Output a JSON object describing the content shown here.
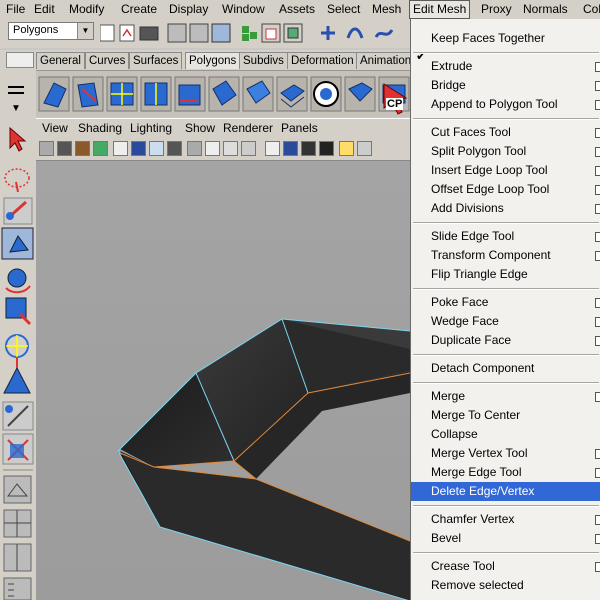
{
  "menubar": {
    "items": [
      "File",
      "Edit",
      "Modify",
      "Create",
      "Display",
      "Window",
      "Assets",
      "Select",
      "Mesh",
      "Edit Mesh",
      "Proxy",
      "Normals",
      "Col"
    ],
    "active_index": 9
  },
  "status_line": {
    "menu_set": "Polygons"
  },
  "shelf": {
    "tabs": [
      "General",
      "Curves",
      "Surfaces",
      "Polygons",
      "Subdivs",
      "Deformation",
      "Animation"
    ],
    "selected_tab_index": 3,
    "cp_label": "CP"
  },
  "panel": {
    "menus": [
      "View",
      "Shading",
      "Lighting",
      "Show",
      "Renderer",
      "Panels"
    ]
  },
  "edit_mesh_menu": {
    "header": {
      "label": "Keep Faces Together",
      "checked": true
    },
    "groups": [
      [
        {
          "label": "Extrude",
          "option": true
        },
        {
          "label": "Bridge",
          "option": true
        },
        {
          "label": "Append to Polygon Tool",
          "option": true
        }
      ],
      [
        {
          "label": "Cut Faces Tool",
          "option": true
        },
        {
          "label": "Split Polygon Tool",
          "option": true
        },
        {
          "label": "Insert Edge Loop Tool",
          "option": true
        },
        {
          "label": "Offset Edge Loop Tool",
          "option": true
        },
        {
          "label": "Add Divisions",
          "option": true
        }
      ],
      [
        {
          "label": "Slide Edge Tool",
          "option": true
        },
        {
          "label": "Transform Component",
          "option": true
        },
        {
          "label": "Flip Triangle Edge",
          "option": false
        }
      ],
      [
        {
          "label": "Poke Face",
          "option": true
        },
        {
          "label": "Wedge Face",
          "option": true
        },
        {
          "label": "Duplicate Face",
          "option": true
        }
      ],
      [
        {
          "label": "Detach Component",
          "option": false
        }
      ],
      [
        {
          "label": "Merge",
          "option": true
        },
        {
          "label": "Merge To Center",
          "option": false
        },
        {
          "label": "Collapse",
          "option": false
        },
        {
          "label": "Merge Vertex Tool",
          "option": true
        },
        {
          "label": "Merge Edge Tool",
          "option": true
        },
        {
          "label": "Delete Edge/Vertex",
          "option": false,
          "highlighted": true
        }
      ],
      [
        {
          "label": "Chamfer Vertex",
          "option": true
        },
        {
          "label": "Bevel",
          "option": true
        }
      ],
      [
        {
          "label": "Crease Tool",
          "option": true
        },
        {
          "label": "Remove selected",
          "option": false
        }
      ]
    ]
  },
  "colors": {
    "menu_highlight": "#3168d5",
    "wire_orange": "#e08a3a",
    "wire_cyan": "#7ad6f2",
    "mesh_dark": "#1c1c1c",
    "mesh_face": "#2e2e2e"
  }
}
